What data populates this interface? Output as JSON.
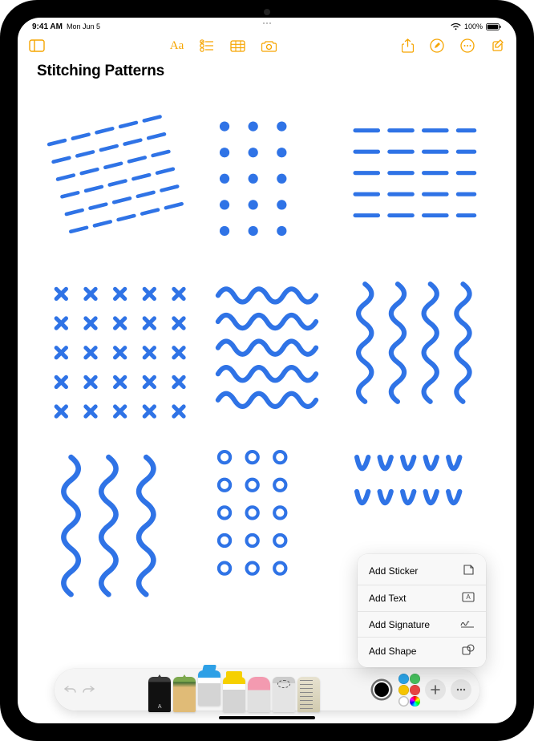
{
  "status": {
    "time": "9:41 AM",
    "date": "Mon Jun 5",
    "battery_pct": "100%"
  },
  "toolbar": {
    "sidebar_label": "Sidebar",
    "format_label": "Aa",
    "share_label": "Share",
    "more_label": "More"
  },
  "note": {
    "title": "Stitching Patterns"
  },
  "popup": {
    "items": [
      {
        "label": "Add Sticker",
        "icon": "sticker-icon"
      },
      {
        "label": "Add Text",
        "icon": "text-box-icon"
      },
      {
        "label": "Add Signature",
        "icon": "signature-icon"
      },
      {
        "label": "Add Shape",
        "icon": "shape-icon"
      }
    ]
  },
  "colors": {
    "current": "#000000",
    "wells": [
      [
        "#2aa4e8",
        "#47c25e"
      ],
      [
        "#f5c400",
        "#f28b2b"
      ],
      [
        "#e74442",
        "#b544c4"
      ]
    ],
    "picker_gradient": "conic"
  },
  "stroke_color": "#2f73e6"
}
